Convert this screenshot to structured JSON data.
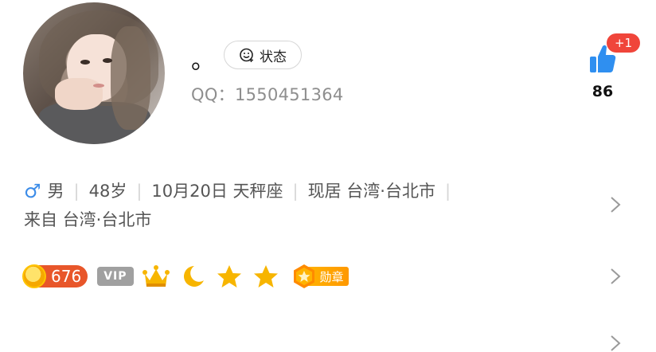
{
  "profile": {
    "nickname": "。",
    "status_label": "状态",
    "qq_label": "QQ：1550451364",
    "likes": "86",
    "likes_delta": "+1"
  },
  "info": {
    "gender_symbol": "♂",
    "gender": "男",
    "age": "48岁",
    "birthday": "10月20日 天秤座",
    "residence": "现居 台湾·台北市",
    "hometown": "来自 台湾·台北市"
  },
  "badges": {
    "coin_value": "676",
    "vip_label": "VIP",
    "medal_label": "勋章"
  },
  "colors": {
    "accent_blue": "#3c8ce8",
    "like_red": "#f0453a",
    "coin_orange": "#e8562a",
    "star_gold": "#f7b500"
  },
  "icons": [
    "status-smile-icon",
    "thumbs-up-icon",
    "male-icon",
    "chevron-right-icon",
    "coin-icon",
    "crown-icon",
    "moon-icon",
    "star-icon",
    "medal-icon"
  ]
}
